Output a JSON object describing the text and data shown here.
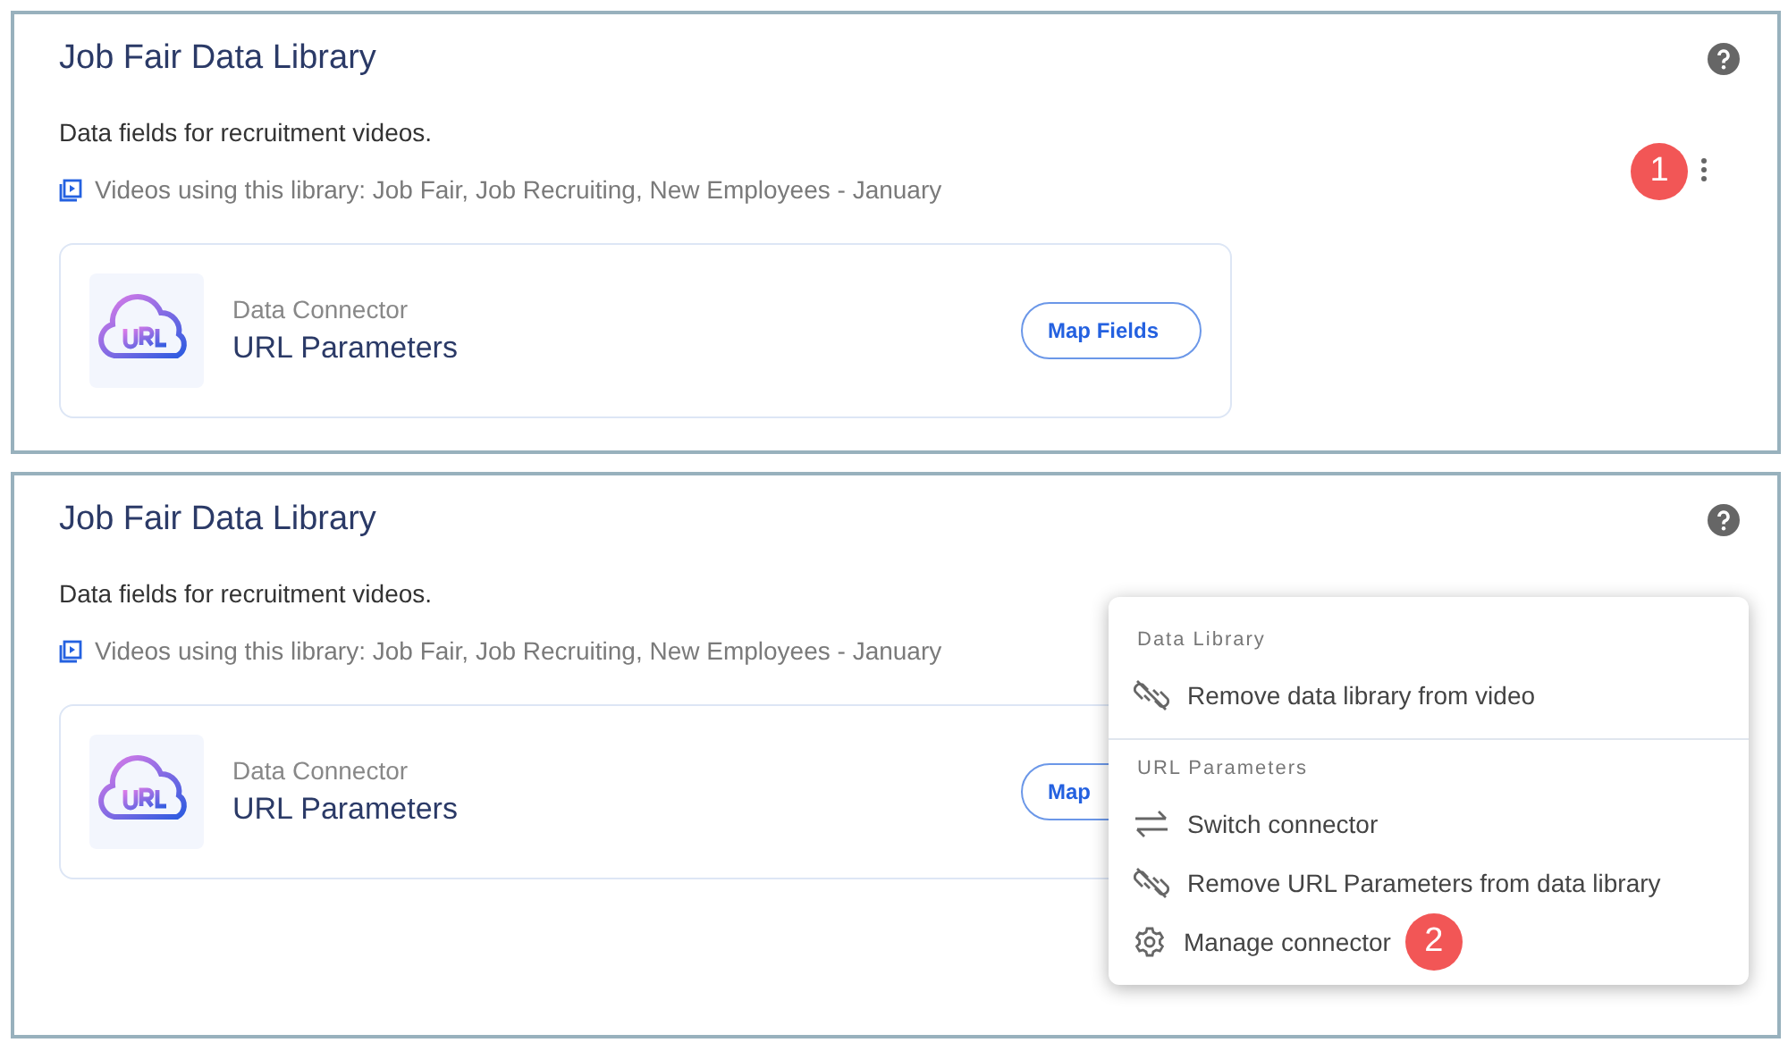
{
  "panels": [
    {
      "title": "Job Fair Data Library",
      "description": "Data fields for recruitment videos.",
      "videos": "Videos using this library: Job Fair, Job Recruiting, New Employees - January",
      "connector": {
        "label": "Data Connector",
        "name": "URL Parameters",
        "button": "Map Fields"
      },
      "callout": "1"
    },
    {
      "title": "Job Fair Data Library",
      "description": "Data fields for recruitment videos.",
      "videos": "Videos using this library: Job Fair, Job Recruiting, New Employees - January",
      "connector": {
        "label": "Data Connector",
        "name": "URL Parameters",
        "button": "Map"
      },
      "menu": {
        "sections": [
          {
            "heading": "Data Library",
            "items": [
              {
                "kind": "unlink",
                "label": "Remove data library from video"
              }
            ]
          },
          {
            "heading": "URL Parameters",
            "items": [
              {
                "kind": "switch",
                "label": "Switch connector"
              },
              {
                "kind": "unlink",
                "label": "Remove URL Parameters from data library"
              },
              {
                "kind": "gear",
                "label": "Manage connector",
                "callout": "2"
              }
            ]
          }
        ]
      }
    }
  ]
}
